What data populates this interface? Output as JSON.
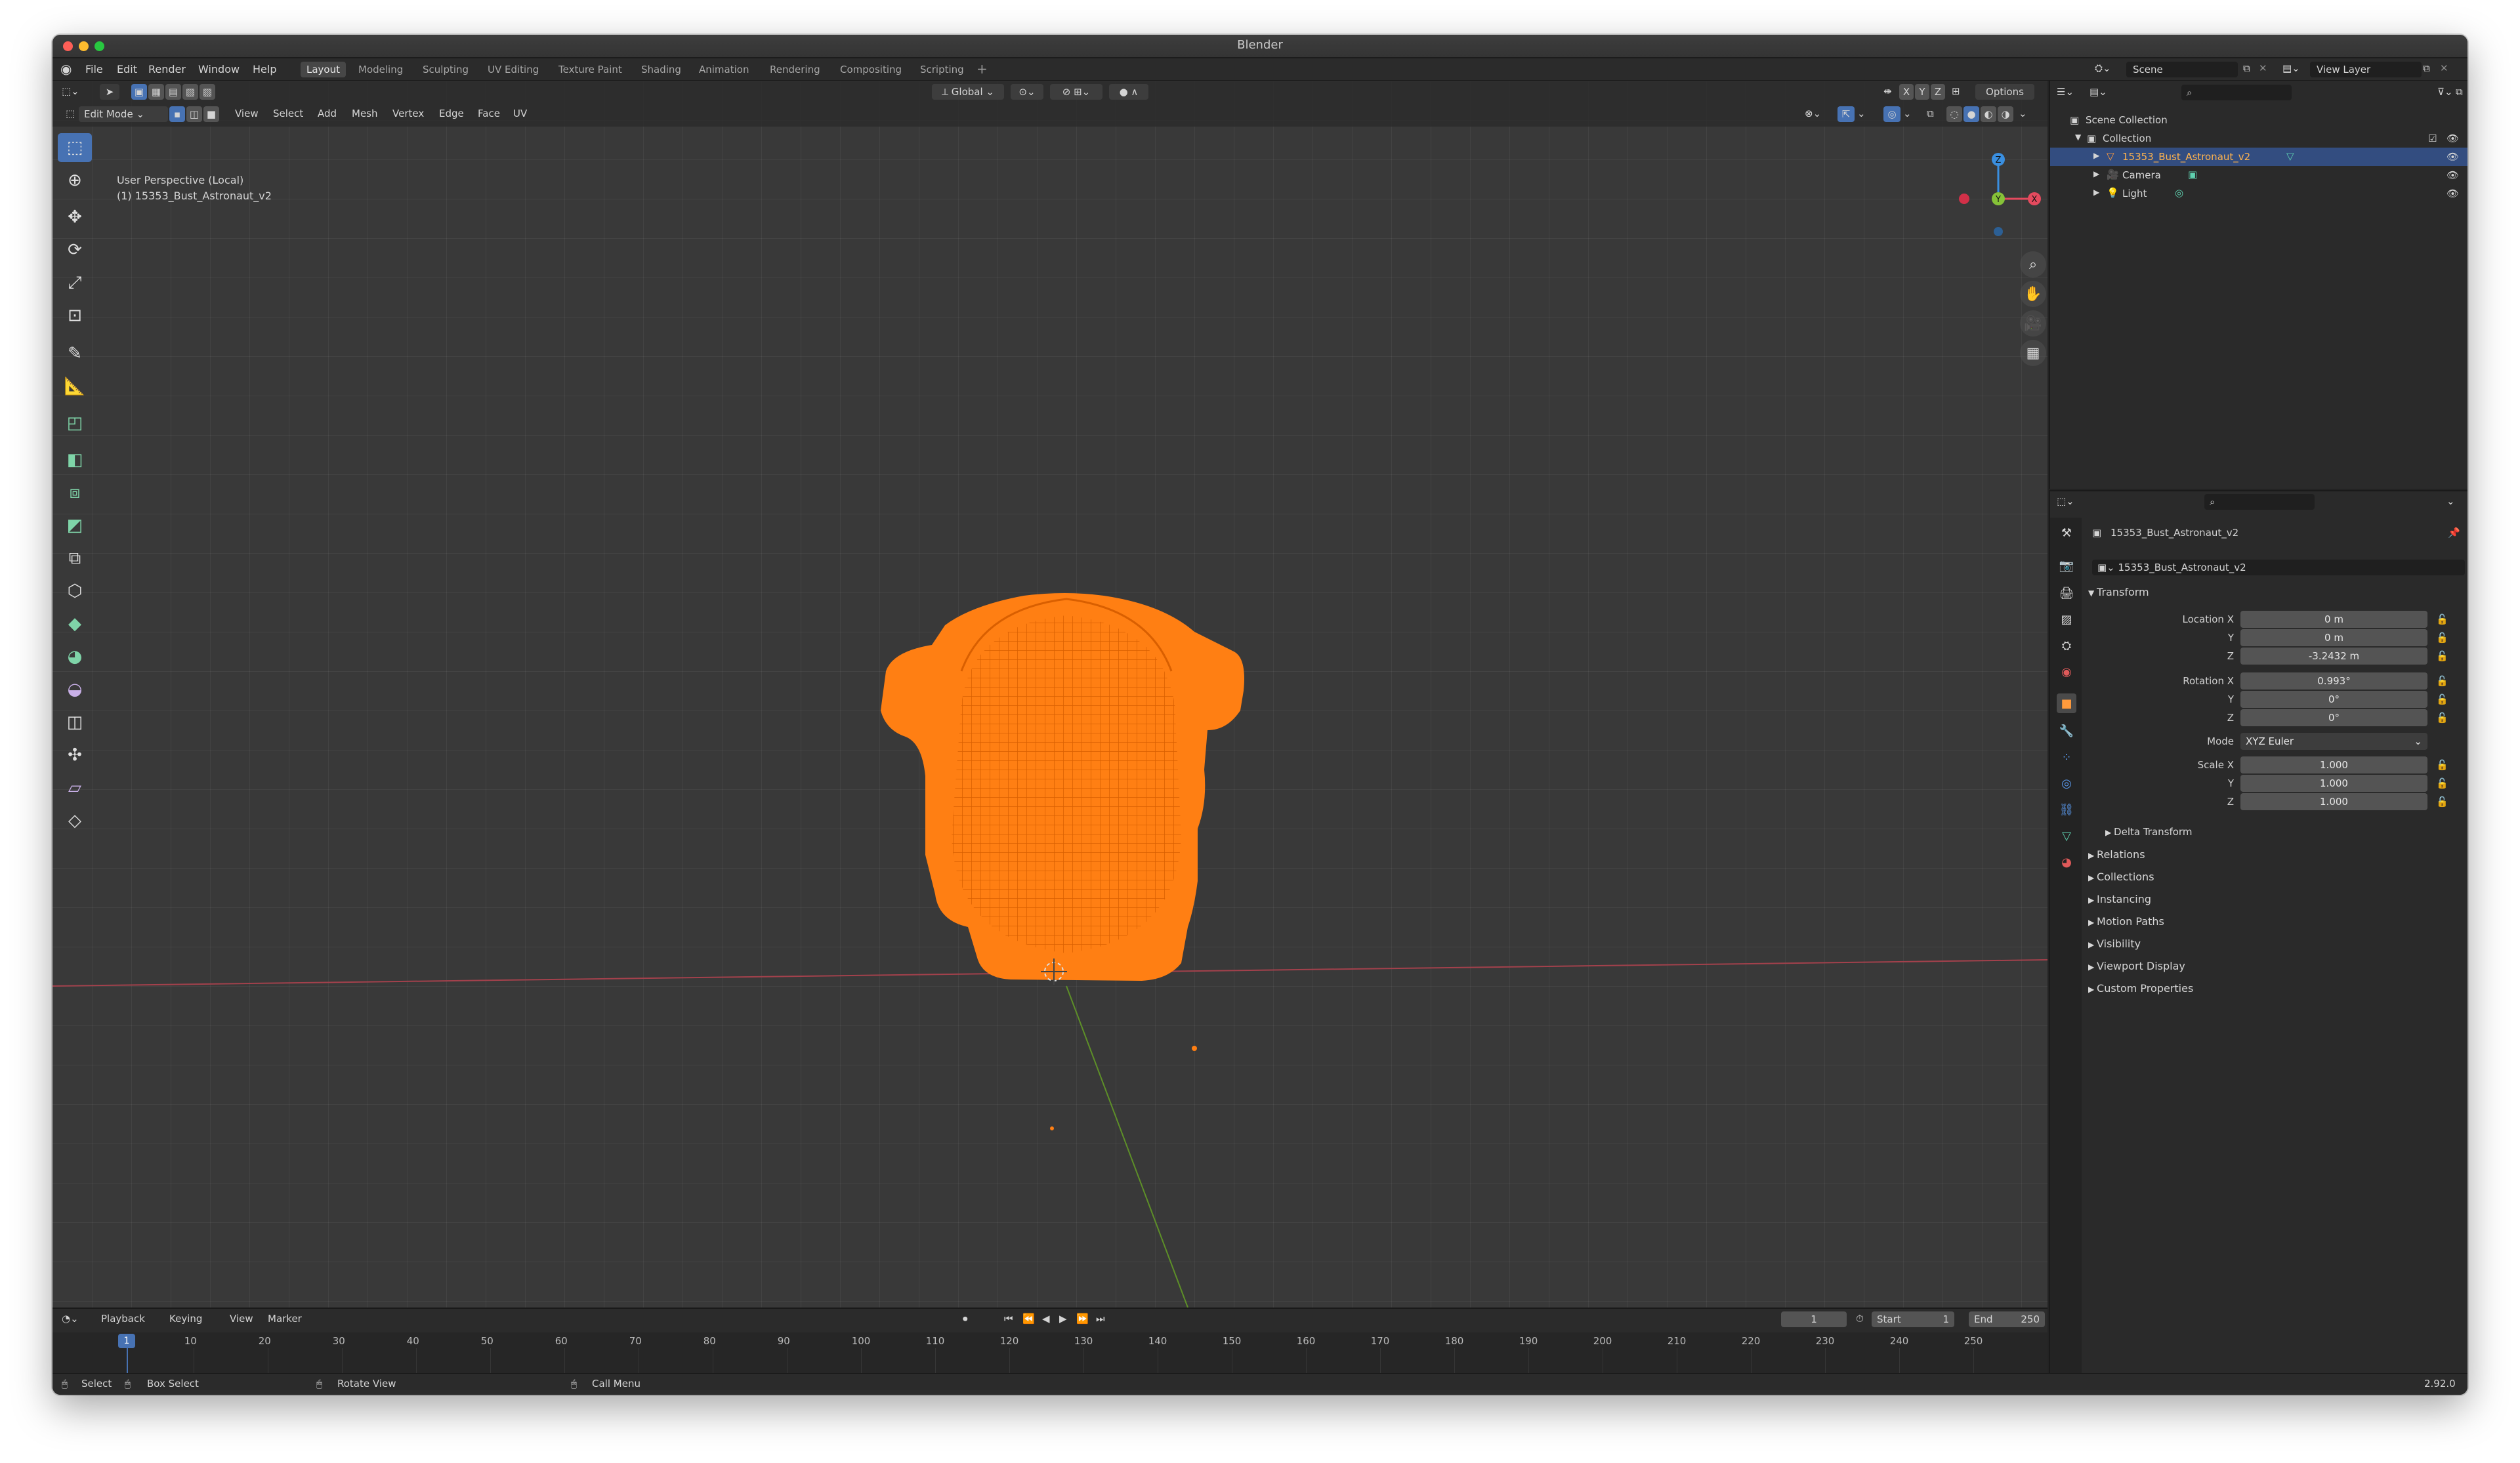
{
  "window": {
    "title": "Blender",
    "traffic_colors": [
      "#fe5f57",
      "#febc2e",
      "#28c840"
    ]
  },
  "menus": [
    "File",
    "Edit",
    "Render",
    "Window",
    "Help"
  ],
  "workspace_tabs": [
    "Layout",
    "Modeling",
    "Sculpting",
    "UV Editing",
    "Texture Paint",
    "Shading",
    "Animation",
    "Rendering",
    "Compositing",
    "Scripting"
  ],
  "active_workspace": "Layout",
  "scene": {
    "name": "Scene",
    "view_layer": "View Layer"
  },
  "viewport_header": {
    "transform_orientation": "Global",
    "axes": [
      "X",
      "Y",
      "Z"
    ],
    "options": "Options",
    "mode": "Edit Mode",
    "menus": [
      "View",
      "Select",
      "Add",
      "Mesh",
      "Vertex",
      "Edge",
      "Face",
      "UV"
    ]
  },
  "viewport": {
    "perspective_label": "User Perspective (Local)",
    "object_label": "(1) 15353_Bust_Astronaut_v2",
    "axis_x_color": "#e54a5e",
    "axis_y_color": "#86c238",
    "axis_z_color": "#3a8fe0",
    "selection_color": "#ff7a0e"
  },
  "gizmo_axes": {
    "x": "X",
    "y": "Y",
    "z": "Z"
  },
  "outliner": {
    "root": "Scene Collection",
    "collection": "Collection",
    "items": [
      {
        "name": "15353_Bust_Astronaut_v2",
        "selected": true
      },
      {
        "name": "Camera",
        "selected": false
      },
      {
        "name": "Light",
        "selected": false
      }
    ]
  },
  "properties": {
    "object_name": "15353_Bust_Astronaut_v2",
    "datablock_name": "15353_Bust_Astronaut_v2",
    "transform_title": "Transform",
    "location_label": "Location X",
    "rotation_label": "Rotation X",
    "scale_label": "Scale X",
    "y_label": "Y",
    "z_label": "Z",
    "location": [
      "0 m",
      "0 m",
      "-3.2432 m"
    ],
    "rotation": [
      "0.993°",
      "0°",
      "0°"
    ],
    "mode_label": "Mode",
    "rotation_mode": "XYZ Euler",
    "scale": [
      "1.000",
      "1.000",
      "1.000"
    ],
    "delta_transform": "Delta Transform",
    "sections": [
      "Relations",
      "Collections",
      "Instancing",
      "Motion Paths",
      "Visibility",
      "Viewport Display",
      "Custom Properties"
    ]
  },
  "timeline": {
    "menus": [
      "Playback",
      "Keying",
      "View",
      "Marker"
    ],
    "current_frame": "1",
    "start_label": "Start",
    "start": "1",
    "end_label": "End",
    "end": "250",
    "ruler": [
      "10",
      "20",
      "30",
      "40",
      "50",
      "60",
      "70",
      "80",
      "90",
      "100",
      "110",
      "120",
      "130",
      "140",
      "150",
      "160",
      "170",
      "180",
      "190",
      "200",
      "210",
      "220",
      "230",
      "240",
      "250"
    ]
  },
  "statusbar": {
    "select": "Select",
    "box_select": "Box Select",
    "rotate_view": "Rotate View",
    "call_menu": "Call Menu",
    "version": "2.92.0"
  }
}
